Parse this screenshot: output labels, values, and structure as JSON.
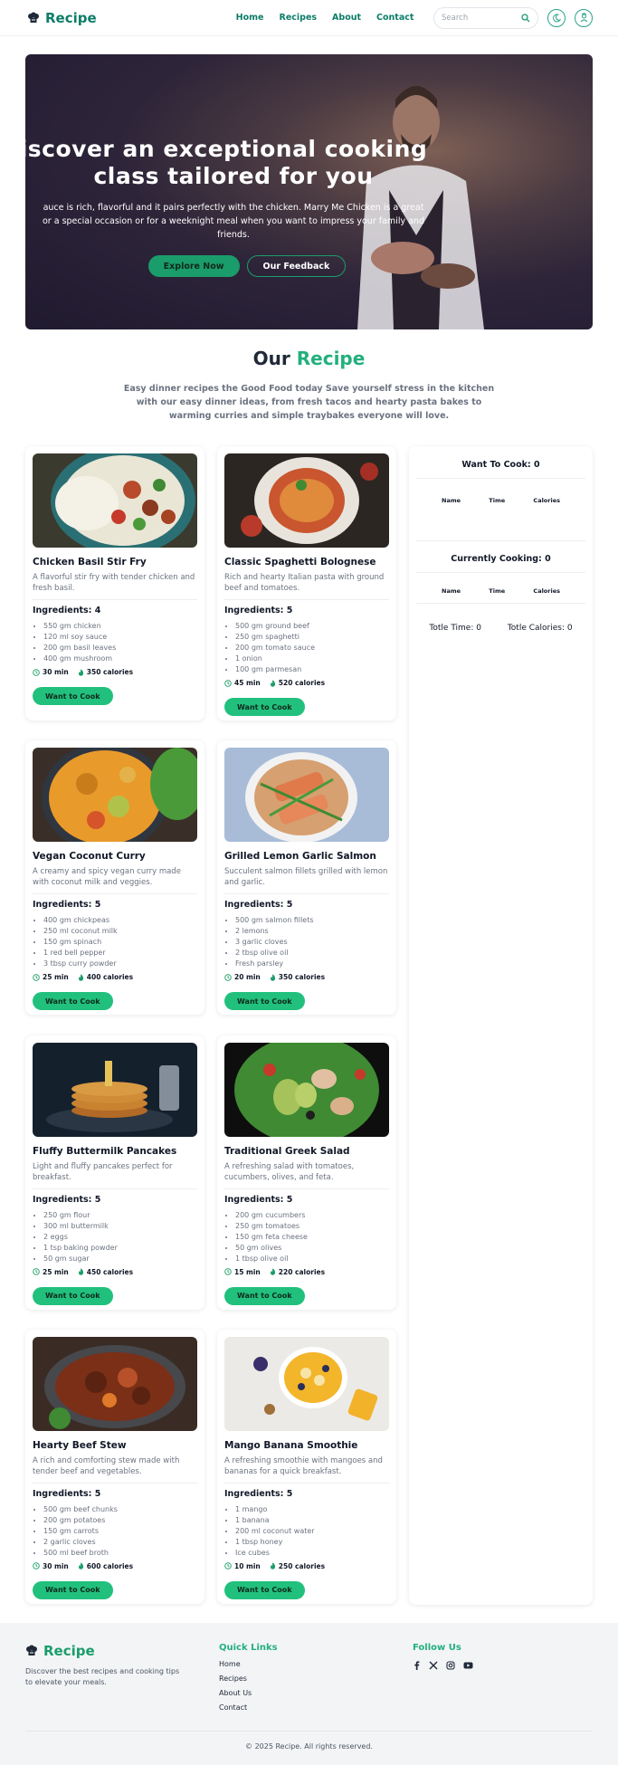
{
  "nav": {
    "brand": "Recipe",
    "links": [
      "Home",
      "Recipes",
      "About",
      "Contact"
    ],
    "search_placeholder": "Search"
  },
  "hero": {
    "title_line1": "iscover an exceptional cooking",
    "title_line2": "class tailored for you",
    "subtitle_line1": "auce is rich, flavorful and it pairs perfectly with the chicken. Marry Me Chicken is a great",
    "subtitle_line2": "or a special occasion or for a weeknight meal when you want to impress your family and",
    "subtitle_line3": "friends.",
    "primary_button": "Explore Now",
    "secondary_button": "Our Feedback"
  },
  "section": {
    "title_a": "Our",
    "title_b": "Recipe",
    "description": "Easy dinner recipes the Good Food today Save yourself stress in the kitchen with our easy dinner ideas, from fresh tacos and hearty pasta bakes to warming curries and simple traybakes everyone will love."
  },
  "recipes": [
    {
      "name": "Chicken Basil Stir Fry",
      "desc": "A flavorful stir fry with tender chicken and fresh basil.",
      "ingredients_label": "Ingredients: 4",
      "ingredients": [
        "550 gm chicken",
        "120 ml soy sauce",
        "200 gm basil leaves",
        "400 gm mushroom"
      ],
      "time": "30 min",
      "calories": "350 calories",
      "button": "Want to Cook"
    },
    {
      "name": "Classic Spaghetti Bolognese",
      "desc": "Rich and hearty Italian pasta with ground beef and tomatoes.",
      "ingredients_label": "Ingredients: 5",
      "ingredients": [
        "500 gm ground beef",
        "250 gm spaghetti",
        "200 gm tomato sauce",
        "1 onion",
        "100 gm parmesan"
      ],
      "time": "45 min",
      "calories": "520 calories",
      "button": "Want to Cook"
    },
    {
      "name": "Vegan Coconut Curry",
      "desc": "A creamy and spicy vegan curry made with coconut milk and veggies.",
      "ingredients_label": "Ingredients: 5",
      "ingredients": [
        "400 gm chickpeas",
        "250 ml coconut milk",
        "150 gm spinach",
        "1 red bell pepper",
        "3 tbsp curry powder"
      ],
      "time": "25 min",
      "calories": "400 calories",
      "button": "Want to Cook"
    },
    {
      "name": "Grilled Lemon Garlic Salmon",
      "desc": "Succulent salmon fillets grilled with lemon and garlic.",
      "ingredients_label": "Ingredients: 5",
      "ingredients": [
        "500 gm salmon fillets",
        "2 lemons",
        "3 garlic cloves",
        "2 tbsp olive oil",
        "Fresh parsley"
      ],
      "time": "20 min",
      "calories": "350 calories",
      "button": "Want to Cook"
    },
    {
      "name": "Fluffy Buttermilk Pancakes",
      "desc": "Light and fluffy pancakes perfect for breakfast.",
      "ingredients_label": "Ingredients: 5",
      "ingredients": [
        "250 gm flour",
        "300 ml buttermilk",
        "2 eggs",
        "1 tsp baking powder",
        "50 gm sugar"
      ],
      "time": "25 min",
      "calories": "450 calories",
      "button": "Want to Cook"
    },
    {
      "name": "Traditional Greek Salad",
      "desc": "A refreshing salad with tomatoes, cucumbers, olives, and feta.",
      "ingredients_label": "Ingredients: 5",
      "ingredients": [
        "200 gm cucumbers",
        "250 gm tomatoes",
        "150 gm feta cheese",
        "50 gm olives",
        "1 tbsp olive oil"
      ],
      "time": "15 min",
      "calories": "220 calories",
      "button": "Want to Cook"
    },
    {
      "name": "Hearty Beef Stew",
      "desc": "A rich and comforting stew made with tender beef and vegetables.",
      "ingredients_label": "Ingredients: 5",
      "ingredients": [
        "500 gm beef chunks",
        "200 gm potatoes",
        "150 gm carrots",
        "2 garlic cloves",
        "500 ml beef broth"
      ],
      "time": "30 min",
      "calories": "600 calories",
      "button": "Want to Cook"
    },
    {
      "name": "Mango Banana Smoothie",
      "desc": "A refreshing smoothie with mangoes and bananas for a quick breakfast.",
      "ingredients_label": "Ingredients: 5",
      "ingredients": [
        "1 mango",
        "1 banana",
        "200 ml coconut water",
        "1 tbsp honey",
        "Ice cubes"
      ],
      "time": "10 min",
      "calories": "250 calories",
      "button": "Want to Cook"
    }
  ],
  "sidebar": {
    "want_title": "Want To Cook: 0",
    "want_cols": [
      "Name",
      "Time",
      "Calories"
    ],
    "cooking_title": "Currently Cooking: 0",
    "cooking_cols": [
      "Name",
      "Time",
      "Calories"
    ],
    "total_time": "Totle Time: 0",
    "total_calories": "Totle Calories: 0"
  },
  "footer": {
    "brand": "Recipe",
    "description": "Discover the best recipes and cooking tips to elevate your meals.",
    "quick_links_title": "Quick Links",
    "quick_links": [
      "Home",
      "Recipes",
      "About Us",
      "Contact"
    ],
    "follow_title": "Follow Us",
    "social_icons": [
      "facebook-icon",
      "x-icon",
      "instagram-icon",
      "youtube-icon"
    ],
    "copyright": "© 2025 Recipe. All rights reserved."
  },
  "colors": {
    "brand": "#0d7d68",
    "accent": "#22b07d",
    "button": "#22c07d"
  }
}
